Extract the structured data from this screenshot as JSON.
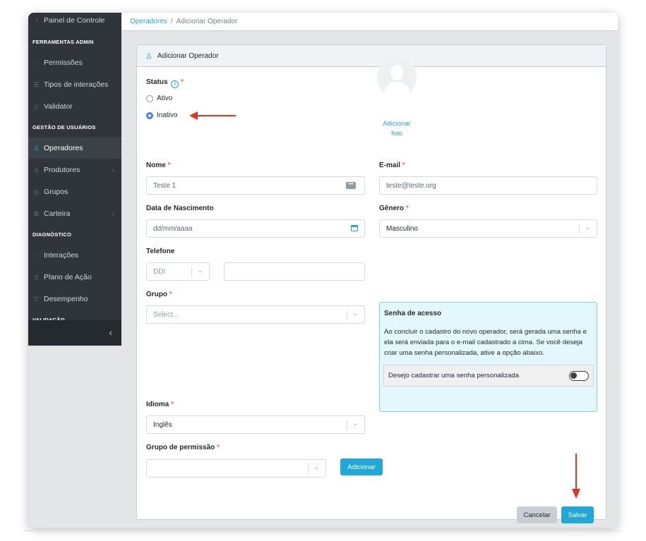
{
  "sidebar": {
    "top_item": "Painel de Controle",
    "sections": {
      "admin": "FERRAMENTAS ADMIN",
      "users": "GESTÃO DE USUÁRIOS",
      "diagnostic": "DIAGNÓSTICO",
      "validation": "VALIDAÇÃO"
    },
    "items": {
      "permissoes": "Permissões",
      "tipos": "Tipos de interações",
      "validator": "Validator",
      "operadores": "Operadores",
      "produtores": "Produtores",
      "grupos": "Grupos",
      "carteira": "Carteira",
      "interacoes": "Interações",
      "plano": "Plano de Ação",
      "desempenho": "Desempenho"
    }
  },
  "breadcrumb": {
    "parent": "Operadores",
    "separator": "/",
    "current": "Adicionar Operador"
  },
  "card": {
    "title": "Adicionar Operador"
  },
  "form": {
    "status": {
      "label": "Status",
      "options": {
        "ativo": "Ativo",
        "inativo": "Inativo"
      },
      "selected": "Inativo"
    },
    "photo": {
      "line1": "Adicionar",
      "line2": "foto"
    },
    "nome": {
      "label": "Nome",
      "value": "Teste 1"
    },
    "email": {
      "label": "E-mail",
      "value": "teste@teste.org"
    },
    "nascimento": {
      "label": "Data de Nascimento",
      "placeholder": "dd/mm/aaaa"
    },
    "genero": {
      "label": "Gênero",
      "value": "Masculino"
    },
    "telefone": {
      "label": "Telefone",
      "ddi": "DDI"
    },
    "grupo": {
      "label": "Grupo",
      "placeholder": "Select..."
    },
    "idioma": {
      "label": "Idioma",
      "value": "Inglês"
    },
    "grupo_permissao": {
      "label": "Grupo de permissão",
      "add_button": "Adicionar"
    },
    "required_mark": "*"
  },
  "password_box": {
    "title": "Senha de acesso",
    "body": "Ao concluir o cadastro do novo operador, será gerada uma senha e ela será enviada para o e-mail cadastrado a cima. Se você deseja criar uma senha personalizada, ative a opção abaixo.",
    "toggle_label": "Desejo cadastrar uma senha personalizada",
    "toggle_on": false
  },
  "actions": {
    "cancel": "Cancelar",
    "save": "Salvar"
  },
  "colors": {
    "accent": "#20a8d8",
    "sidebar": "#2f353a",
    "annotation_arrow": "#e8321e",
    "required": "#f86c6b"
  }
}
